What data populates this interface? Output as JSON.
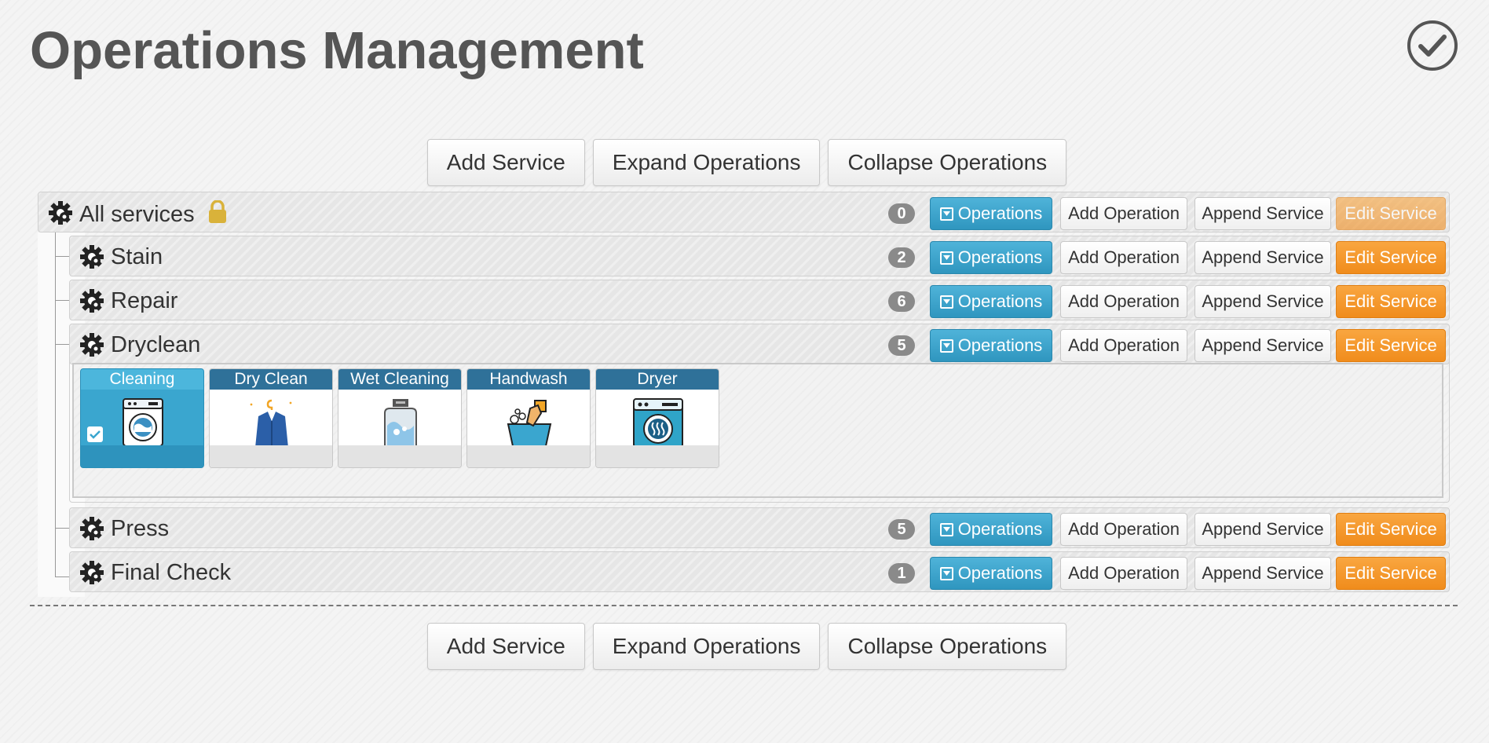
{
  "page": {
    "title": "Operations Management"
  },
  "toolbar": {
    "add_service": "Add Service",
    "expand_operations": "Expand Operations",
    "collapse_operations": "Collapse Operations"
  },
  "row_buttons": {
    "operations": "Operations",
    "add_operation": "Add Operation",
    "append_service": "Append Service",
    "edit_service": "Edit Service"
  },
  "services": [
    {
      "name": "All services",
      "count": "0",
      "locked": true
    },
    {
      "name": "Stain",
      "count": "2"
    },
    {
      "name": "Repair",
      "count": "6"
    },
    {
      "name": "Dryclean",
      "count": "5",
      "expanded": true
    },
    {
      "name": "Press",
      "count": "5"
    },
    {
      "name": "Final Check",
      "count": "1"
    }
  ],
  "operations": [
    {
      "label": "Cleaning",
      "icon": "washing-machine-icon",
      "selected": true
    },
    {
      "label": "Dry Clean",
      "icon": "suit-hanger-icon"
    },
    {
      "label": "Wet Cleaning",
      "icon": "detergent-bottle-icon"
    },
    {
      "label": "Handwash",
      "icon": "hand-wash-basin-icon"
    },
    {
      "label": "Dryer",
      "icon": "dryer-icon"
    }
  ],
  "colors": {
    "operations_button": "#3aa6cf",
    "edit_button": "#f5991f",
    "card_header": "#2f7199",
    "badge": "#8a8a8a",
    "lock": "#d9b23a"
  }
}
